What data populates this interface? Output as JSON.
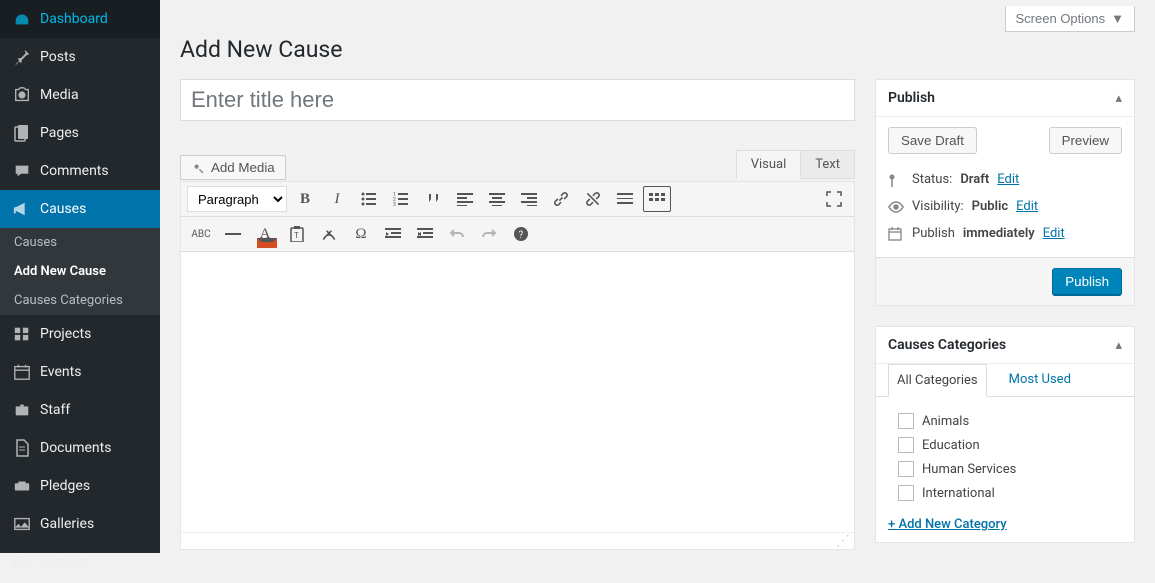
{
  "screen_options": {
    "label": "Screen Options"
  },
  "page": {
    "title": "Add New Cause"
  },
  "sidebar": {
    "items": [
      {
        "label": "Dashboard",
        "icon": "dashboard"
      },
      {
        "label": "Posts",
        "icon": "pin"
      },
      {
        "label": "Media",
        "icon": "media"
      },
      {
        "label": "Pages",
        "icon": "pages"
      },
      {
        "label": "Comments",
        "icon": "comments"
      },
      {
        "label": "Causes",
        "icon": "megaphone",
        "current": true
      },
      {
        "label": "Projects",
        "icon": "projects"
      },
      {
        "label": "Events",
        "icon": "calendar"
      },
      {
        "label": "Staff",
        "icon": "staff"
      },
      {
        "label": "Documents",
        "icon": "documents"
      },
      {
        "label": "Pledges",
        "icon": "pledges"
      },
      {
        "label": "Galleries",
        "icon": "galleries"
      },
      {
        "label": "Contact",
        "icon": "contact"
      }
    ],
    "submenu": [
      {
        "label": "Causes"
      },
      {
        "label": "Add New Cause",
        "current": true
      },
      {
        "label": "Causes Categories"
      }
    ]
  },
  "title_field": {
    "placeholder": "Enter title here",
    "value": ""
  },
  "media_button": {
    "label": "Add Media"
  },
  "editor": {
    "tabs": {
      "visual": "Visual",
      "text": "Text",
      "active": "visual"
    },
    "format_selector": {
      "value": "Paragraph"
    }
  },
  "publish": {
    "heading": "Publish",
    "save_draft": "Save Draft",
    "preview": "Preview",
    "status_label": "Status:",
    "status_value": "Draft",
    "visibility_label": "Visibility:",
    "visibility_value": "Public",
    "schedule_label": "Publish",
    "schedule_value": "immediately",
    "edit": "Edit",
    "submit": "Publish"
  },
  "categories": {
    "heading": "Causes Categories",
    "tabs": {
      "all": "All Categories",
      "most_used": "Most Used"
    },
    "items": [
      {
        "label": "Animals"
      },
      {
        "label": "Education"
      },
      {
        "label": "Human Services"
      },
      {
        "label": "International"
      }
    ],
    "add_new": "+ Add New Category"
  }
}
